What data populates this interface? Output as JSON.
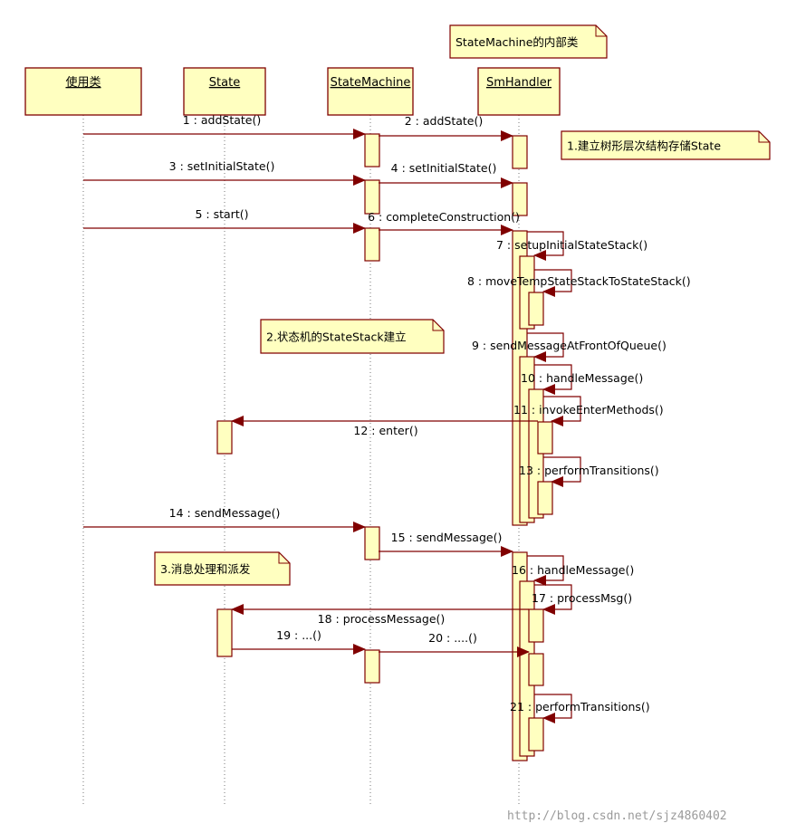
{
  "diagram_type": "sequence",
  "colors": {
    "box_fill": "#ffffc0",
    "box_stroke": "#800000",
    "message_line": "#800000",
    "lifeline": "#777777"
  },
  "lifelines": [
    {
      "name": "使用类"
    },
    {
      "name": "State"
    },
    {
      "name": "StateMachine"
    },
    {
      "name": "SmHandler"
    }
  ],
  "notes": [
    {
      "text": "StateMachine的内部类"
    },
    {
      "text": "1.建立树形层次结构存储State"
    },
    {
      "text": "2.状态机的StateStack建立"
    },
    {
      "text": "3.消息处理和派发"
    }
  ],
  "messages": [
    {
      "label": "1 : addState()",
      "from": "使用类",
      "to": "StateMachine"
    },
    {
      "label": "2 : addState()",
      "from": "StateMachine",
      "to": "SmHandler"
    },
    {
      "label": "3 : setInitialState()",
      "from": "使用类",
      "to": "StateMachine"
    },
    {
      "label": "4 : setInitialState()",
      "from": "StateMachine",
      "to": "SmHandler"
    },
    {
      "label": "5 : start()",
      "from": "使用类",
      "to": "StateMachine"
    },
    {
      "label": "6 : completeConstruction()",
      "from": "StateMachine",
      "to": "SmHandler"
    },
    {
      "label": "7 : setupInitialStateStack()",
      "from": "SmHandler",
      "to": "SmHandler"
    },
    {
      "label": "8 : moveTempStateStackToStateStack()",
      "from": "SmHandler",
      "to": "SmHandler"
    },
    {
      "label": "9 : sendMessageAtFrontOfQueue()",
      "from": "SmHandler",
      "to": "SmHandler"
    },
    {
      "label": "10 : handleMessage()",
      "from": "SmHandler",
      "to": "SmHandler"
    },
    {
      "label": "11 : invokeEnterMethods()",
      "from": "SmHandler",
      "to": "SmHandler"
    },
    {
      "label": "12 : enter()",
      "from": "SmHandler",
      "to": "State"
    },
    {
      "label": "13 : performTransitions()",
      "from": "SmHandler",
      "to": "SmHandler"
    },
    {
      "label": "14 : sendMessage()",
      "from": "使用类",
      "to": "StateMachine"
    },
    {
      "label": "15 : sendMessage()",
      "from": "StateMachine",
      "to": "SmHandler"
    },
    {
      "label": "16 : handleMessage()",
      "from": "SmHandler",
      "to": "SmHandler"
    },
    {
      "label": "17 : processMsg()",
      "from": "SmHandler",
      "to": "SmHandler"
    },
    {
      "label": "18 : processMessage()",
      "from": "SmHandler",
      "to": "State"
    },
    {
      "label": "19 : ...()",
      "from": "State",
      "to": "StateMachine"
    },
    {
      "label": "20 : ....()",
      "from": "StateMachine",
      "to": "SmHandler"
    },
    {
      "label": "21 : performTransitions()",
      "from": "SmHandler",
      "to": "SmHandler"
    }
  ],
  "watermark": "http://blog.csdn.net/sjz4860402"
}
